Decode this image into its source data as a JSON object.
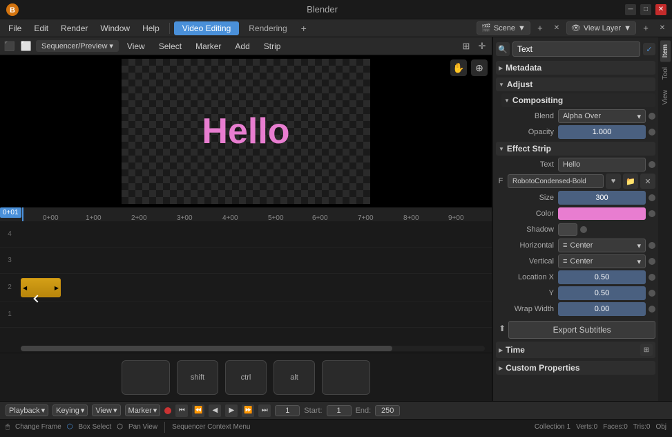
{
  "app": {
    "title": "Blender",
    "logo": "🔷"
  },
  "title_bar": {
    "title": "Blender",
    "minimize": "─",
    "restore": "□",
    "close": "✕"
  },
  "menu_bar": {
    "items": [
      "File",
      "Edit",
      "Render",
      "Window",
      "Help"
    ],
    "workspace_tab": "Video Editing",
    "rendering_tab": "Rendering",
    "add_tab": "+",
    "scene_label": "Scene",
    "view_layer_label": "View Layer"
  },
  "sequencer_header": {
    "mode": "Sequencer/Preview",
    "view": "View",
    "select": "Select",
    "marker": "Marker",
    "add": "Add",
    "strip": "Strip"
  },
  "preview": {
    "text": "Hello"
  },
  "timeline": {
    "rulers": [
      "0+00",
      "1+00",
      "2+00",
      "3+00",
      "4+00",
      "5+00",
      "6+00",
      "7+00",
      "8+00",
      "9+00"
    ],
    "current_frame": "0+01",
    "strip": {
      "track": 2,
      "color": "yellow",
      "start": 0,
      "width": 60
    }
  },
  "keyboard_shortcuts": [
    {
      "key": "",
      "id": "key-blank1"
    },
    {
      "key": "shift",
      "id": "key-shift"
    },
    {
      "key": "ctrl",
      "id": "key-ctrl"
    },
    {
      "key": "alt",
      "id": "key-alt"
    },
    {
      "key": "",
      "id": "key-blank2"
    }
  ],
  "right_panel": {
    "vtabs": [
      "Item",
      "Tool",
      "View"
    ],
    "name": "Text",
    "sections": {
      "metadata": "Metadata",
      "adjust": "Adjust",
      "compositing": "Compositing",
      "effect_strip": "Effect Strip",
      "time": "Time",
      "custom_props": "Custom Properties"
    },
    "blend_label": "Blend",
    "blend_value": "Alpha Over",
    "opacity_label": "Opacity",
    "opacity_value": "1.000",
    "effect_strip": {
      "text_label": "Text",
      "text_value": "Hello",
      "font_name": "RobotoCondensed-Bold",
      "size_label": "Size",
      "size_value": "300",
      "color_label": "Color",
      "color_value": "#e87dd0",
      "shadow_label": "Shadow",
      "shadow_color": "#444444",
      "horizontal_label": "Horizontal",
      "horizontal_value": "Center",
      "vertical_label": "Vertical",
      "vertical_value": "Center",
      "location_x_label": "Location X",
      "location_x_value": "0.50",
      "location_y_label": "Y",
      "location_y_value": "0.50",
      "wrap_width_label": "Wrap Width",
      "wrap_width_value": "0.00"
    },
    "export_subtitles": "Export Subtitles"
  },
  "playback_bar": {
    "playback_label": "Playback",
    "keying_label": "Keying",
    "view_label": "View",
    "marker_label": "Marker",
    "start_label": "Start:",
    "start_value": "1",
    "end_label": "End:",
    "end_value": "250",
    "current_frame": "1"
  },
  "status_bar": {
    "context_menu": "Sequencer Context Menu",
    "change_frame": "Change Frame",
    "box_select": "Box Select",
    "pan_view": "Pan View",
    "collection": "Collection 1",
    "verts": "Verts:0",
    "faces": "Faces:0",
    "tris": "Tris:0",
    "obj": "Obj"
  }
}
